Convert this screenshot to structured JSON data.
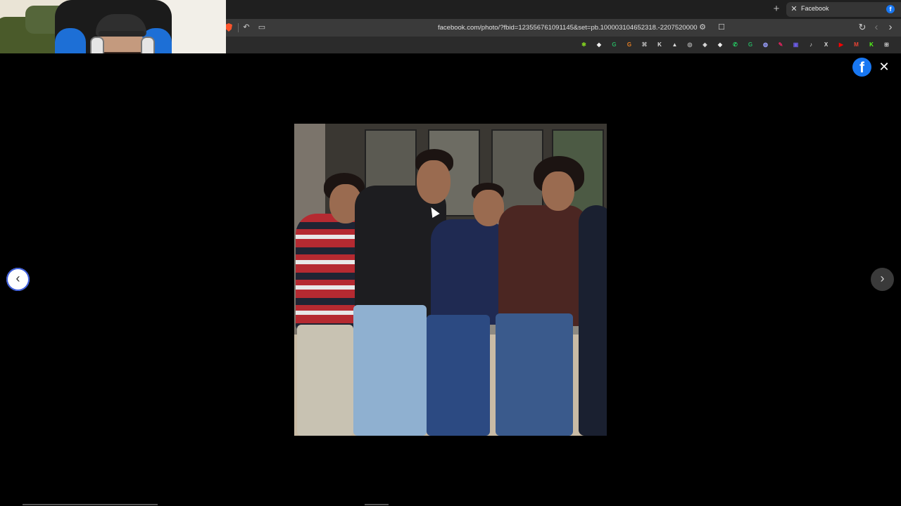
{
  "browser": {
    "tab": {
      "title": "Facebook",
      "close_icon": "✕",
      "favicon": "f"
    },
    "new_tab": "+",
    "url": "facebook.com/photo/?fbid=123556761091145&set=pb.100003104652318.-2207520000",
    "icons": {
      "brave": "brave-icon",
      "reader": "↶",
      "screenshot": "▭",
      "site_settings": "⚙",
      "bookmark": "☐",
      "reload": "↻",
      "back": "‹",
      "forward": "›"
    },
    "extensions": [
      {
        "name": "ext-a",
        "glyph": "✱",
        "color": "#7ecb20"
      },
      {
        "name": "ext-b",
        "glyph": "◆",
        "color": "#f1f1f1"
      },
      {
        "name": "ext-c",
        "glyph": "G",
        "color": "#27ae60"
      },
      {
        "name": "ext-d",
        "glyph": "G",
        "color": "#e67e22"
      },
      {
        "name": "ext-e",
        "glyph": "⌘",
        "color": "#bbbbbb"
      },
      {
        "name": "ext-f",
        "glyph": "K",
        "color": "#dddddd"
      },
      {
        "name": "ext-g",
        "glyph": "▲",
        "color": "#dddddd"
      },
      {
        "name": "ext-h",
        "glyph": "◎",
        "color": "#bbbbbb"
      },
      {
        "name": "ext-i",
        "glyph": "◈",
        "color": "#dddddd"
      },
      {
        "name": "ext-j",
        "glyph": "◆",
        "color": "#eeeeee"
      },
      {
        "name": "ext-whatsapp",
        "glyph": "✆",
        "color": "#25d366"
      },
      {
        "name": "ext-k",
        "glyph": "G",
        "color": "#27ae60"
      },
      {
        "name": "ext-l",
        "glyph": "◍",
        "color": "#9aa0ff"
      },
      {
        "name": "ext-m",
        "glyph": "✎",
        "color": "#e0245e"
      },
      {
        "name": "ext-n",
        "glyph": "▣",
        "color": "#6c5ce7"
      },
      {
        "name": "ext-tiktok",
        "glyph": "♪",
        "color": "#dddddd"
      },
      {
        "name": "ext-x",
        "glyph": "X",
        "color": "#dddddd"
      },
      {
        "name": "ext-youtube",
        "glyph": "▶",
        "color": "#ff0000"
      },
      {
        "name": "ext-gmail",
        "glyph": "M",
        "color": "#ea4335"
      },
      {
        "name": "ext-kick",
        "glyph": "K",
        "color": "#53fc18"
      },
      {
        "name": "ext-menu",
        "glyph": "⊞",
        "color": "#cccccc"
      }
    ]
  },
  "viewer": {
    "facebook_logo": "f",
    "close_icon": "✕",
    "prev_icon": "‹",
    "next_icon": "›"
  }
}
